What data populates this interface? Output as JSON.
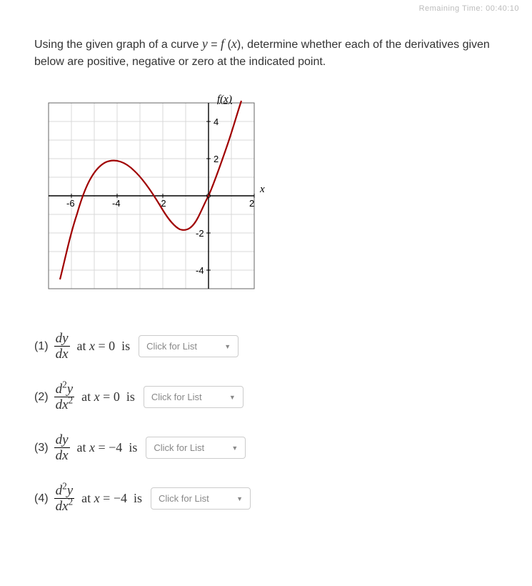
{
  "timer_text": "Remaining Time: 00:40:10",
  "question_html": "Using the given graph of a curve <span class='math-it'>y</span> = <span class='math-it'>f</span> (<span class='math-it'>x</span>), determine whether each of the derivatives given below are positive, negative or zero at the indicated point.",
  "chart_data": {
    "type": "line",
    "title": "",
    "xlabel": "x",
    "ylabel": "f(x)",
    "xlim": [
      -7,
      2
    ],
    "ylim": [
      -5,
      5
    ],
    "x_ticks": [
      -6,
      -4,
      -2,
      2
    ],
    "y_ticks": [
      -4,
      -2,
      2,
      4
    ],
    "series": [
      {
        "name": "f(x)",
        "color": "#a00000",
        "x": [
          -6.5,
          -6,
          -5.5,
          -5,
          -4.5,
          -4,
          -3.5,
          -3,
          -2.5,
          -2,
          -1.5,
          -1,
          -0.5,
          0,
          0.5,
          1,
          1.5
        ],
        "y": [
          -4.5,
          -2.0,
          0.4,
          1.5,
          1.9,
          1.8,
          1.3,
          0.4,
          -0.6,
          -1.4,
          -1.8,
          -1.7,
          -1.0,
          0.0,
          1.6,
          3.4,
          5.0
        ]
      }
    ]
  },
  "questions": [
    {
      "num": "(1)",
      "deriv_type": 1,
      "point": "0",
      "dropdown_label": "Click for List"
    },
    {
      "num": "(2)",
      "deriv_type": 2,
      "point": "0",
      "dropdown_label": "Click for List"
    },
    {
      "num": "(3)",
      "deriv_type": 1,
      "point": "−4",
      "dropdown_label": "Click for List"
    },
    {
      "num": "(4)",
      "deriv_type": 2,
      "point": "−4",
      "dropdown_label": "Click for List"
    }
  ],
  "frac1": {
    "num": "dy",
    "den": "dx"
  },
  "frac2": {
    "num_a": "d",
    "num_sup": "2",
    "num_b": "y",
    "den_a": "dx",
    "den_sup": "2"
  }
}
